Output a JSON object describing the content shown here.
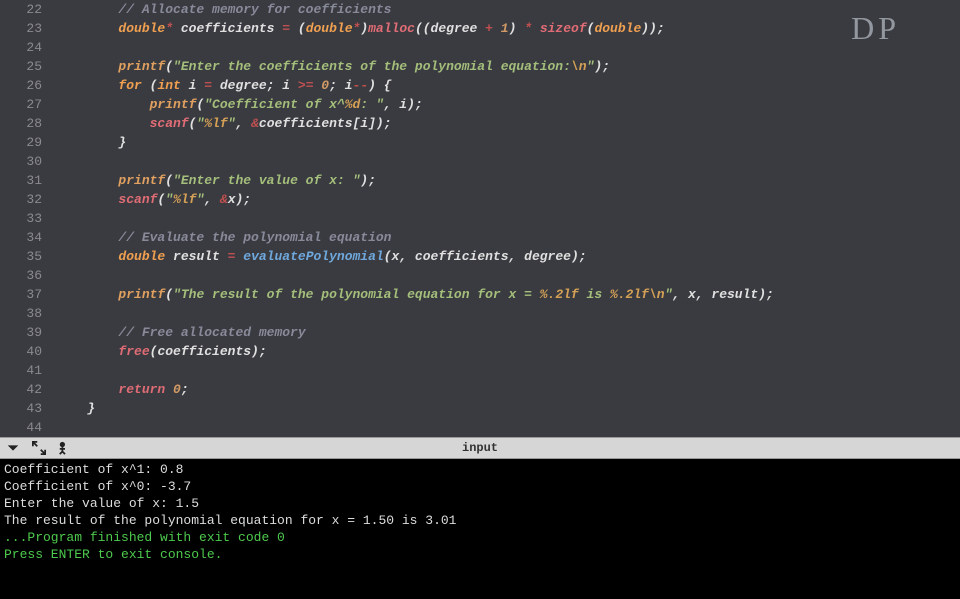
{
  "watermark": "DP",
  "gutter": {
    "start": 22,
    "end": 44,
    "fold_marker_line": 26
  },
  "code": {
    "22": {
      "indent": 2,
      "tokens": [
        [
          "c-comment",
          "// Allocate memory for coefficients"
        ]
      ]
    },
    "23": {
      "indent": 2,
      "tokens": [
        [
          "c-type",
          "double"
        ],
        [
          "c-op",
          "*"
        ],
        [
          "c-ident",
          " coefficients "
        ],
        [
          "c-op",
          "="
        ],
        [
          "c-punct",
          " ("
        ],
        [
          "c-type",
          "double"
        ],
        [
          "c-op",
          "*"
        ],
        [
          "c-punct",
          ")"
        ],
        [
          "c-malloc",
          "malloc"
        ],
        [
          "c-punct",
          "(("
        ],
        [
          "c-ident",
          "degree "
        ],
        [
          "c-op",
          "+"
        ],
        [
          "c-num",
          " 1"
        ],
        [
          "c-punct",
          ") "
        ],
        [
          "c-op",
          "*"
        ],
        [
          "c-punct",
          " "
        ],
        [
          "c-sizeof",
          "sizeof"
        ],
        [
          "c-punct",
          "("
        ],
        [
          "c-type",
          "double"
        ],
        [
          "c-punct",
          "));"
        ]
      ]
    },
    "24": {
      "indent": 0,
      "tokens": []
    },
    "25": {
      "indent": 2,
      "tokens": [
        [
          "c-printf",
          "printf"
        ],
        [
          "c-punct",
          "("
        ],
        [
          "c-string",
          "\"Enter the coefficients of the polynomial equation:"
        ],
        [
          "c-escape",
          "\\n"
        ],
        [
          "c-string",
          "\""
        ],
        [
          "c-punct",
          ");"
        ]
      ]
    },
    "26": {
      "indent": 2,
      "tokens": [
        [
          "c-keyword",
          "for"
        ],
        [
          "c-punct",
          " ("
        ],
        [
          "c-type",
          "int"
        ],
        [
          "c-ident",
          " i "
        ],
        [
          "c-op",
          "="
        ],
        [
          "c-ident",
          " degree; i "
        ],
        [
          "c-op",
          ">="
        ],
        [
          "c-num",
          " 0"
        ],
        [
          "c-punct",
          "; i"
        ],
        [
          "c-op",
          "--"
        ],
        [
          "c-punct",
          ") {"
        ]
      ]
    },
    "27": {
      "indent": 3,
      "tokens": [
        [
          "c-printf",
          "printf"
        ],
        [
          "c-punct",
          "("
        ],
        [
          "c-string",
          "\"Coefficient of x^"
        ],
        [
          "c-escape",
          "%d"
        ],
        [
          "c-string",
          ": \""
        ],
        [
          "c-punct",
          ", i);"
        ]
      ]
    },
    "28": {
      "indent": 3,
      "tokens": [
        [
          "c-scanf",
          "scanf"
        ],
        [
          "c-punct",
          "("
        ],
        [
          "c-string",
          "\""
        ],
        [
          "c-escape",
          "%lf"
        ],
        [
          "c-string",
          "\""
        ],
        [
          "c-punct",
          ", "
        ],
        [
          "c-op",
          "&"
        ],
        [
          "c-ident",
          "coefficients[i]);"
        ]
      ]
    },
    "29": {
      "indent": 2,
      "tokens": [
        [
          "c-punct",
          "}"
        ]
      ]
    },
    "30": {
      "indent": 0,
      "tokens": []
    },
    "31": {
      "indent": 2,
      "tokens": [
        [
          "c-printf",
          "printf"
        ],
        [
          "c-punct",
          "("
        ],
        [
          "c-string",
          "\"Enter the value of x: \""
        ],
        [
          "c-punct",
          ");"
        ]
      ]
    },
    "32": {
      "indent": 2,
      "tokens": [
        [
          "c-scanf",
          "scanf"
        ],
        [
          "c-punct",
          "("
        ],
        [
          "c-string",
          "\""
        ],
        [
          "c-escape",
          "%lf"
        ],
        [
          "c-string",
          "\""
        ],
        [
          "c-punct",
          ", "
        ],
        [
          "c-op",
          "&"
        ],
        [
          "c-ident",
          "x);"
        ]
      ]
    },
    "33": {
      "indent": 0,
      "tokens": []
    },
    "34": {
      "indent": 2,
      "tokens": [
        [
          "c-comment",
          "// Evaluate the polynomial equation"
        ]
      ]
    },
    "35": {
      "indent": 2,
      "tokens": [
        [
          "c-type",
          "double"
        ],
        [
          "c-ident",
          " result "
        ],
        [
          "c-op",
          "="
        ],
        [
          "c-ident",
          " "
        ],
        [
          "c-func",
          "evaluatePolynomial"
        ],
        [
          "c-punct",
          "(x, coefficients, degree);"
        ]
      ]
    },
    "36": {
      "indent": 0,
      "tokens": []
    },
    "37": {
      "indent": 2,
      "tokens": [
        [
          "c-printf",
          "printf"
        ],
        [
          "c-punct",
          "("
        ],
        [
          "c-string",
          "\"The result of the polynomial equation for x = "
        ],
        [
          "c-escape",
          "%.2lf"
        ],
        [
          "c-string",
          " is "
        ],
        [
          "c-escape",
          "%.2lf"
        ],
        [
          "c-escape",
          "\\n"
        ],
        [
          "c-string",
          "\""
        ],
        [
          "c-punct",
          ", x, result);"
        ]
      ]
    },
    "38": {
      "indent": 0,
      "tokens": []
    },
    "39": {
      "indent": 2,
      "tokens": [
        [
          "c-comment",
          "// Free allocated memory"
        ]
      ]
    },
    "40": {
      "indent": 2,
      "tokens": [
        [
          "c-free",
          "free"
        ],
        [
          "c-punct",
          "(coefficients);"
        ]
      ]
    },
    "41": {
      "indent": 0,
      "tokens": []
    },
    "42": {
      "indent": 2,
      "tokens": [
        [
          "c-return",
          "return"
        ],
        [
          "c-num",
          " 0"
        ],
        [
          "c-punct",
          ";"
        ]
      ]
    },
    "43": {
      "indent": 1,
      "tokens": [
        [
          "c-punct",
          "}"
        ]
      ]
    },
    "44": {
      "indent": 0,
      "tokens": []
    }
  },
  "panel": {
    "title": "input"
  },
  "terminal": {
    "lines": [
      {
        "cls": "",
        "text": "Coefficient of x^1: 0.8"
      },
      {
        "cls": "",
        "text": "Coefficient of x^0: -3.7"
      },
      {
        "cls": "",
        "text": "Enter the value of x: 1.5"
      },
      {
        "cls": "",
        "text": "The result of the polynomial equation for x = 1.50 is 3.01"
      },
      {
        "cls": "",
        "text": ""
      },
      {
        "cls": "",
        "text": ""
      },
      {
        "cls": "green",
        "text": "...Program finished with exit code 0"
      },
      {
        "cls": "green",
        "text": "Press ENTER to exit console."
      }
    ]
  }
}
